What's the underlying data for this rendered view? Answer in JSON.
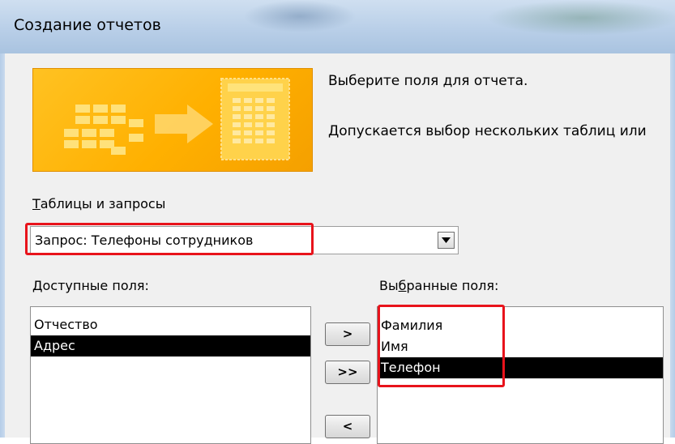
{
  "window": {
    "title": "Создание отчетов"
  },
  "instructions": {
    "line1": "Выберите поля для отчета.",
    "line2": "Допускается выбор нескольких таблиц или"
  },
  "tables": {
    "label_prefix": "",
    "label_accel": "Т",
    "label_rest": "аблицы и запросы",
    "selected": "Запрос: Телефоны сотрудников"
  },
  "available": {
    "label_accel": "Д",
    "label_rest": "оступные поля:",
    "items": [
      "Отчество",
      "Адрес"
    ],
    "selected_index": 1
  },
  "selected_fields": {
    "label_prefix": "Вы",
    "label_accel": "б",
    "label_rest": "ранные поля:",
    "items": [
      "Фамилия",
      "Имя",
      "Телефон"
    ],
    "selected_index": 2
  },
  "buttons": {
    "add_one": ">",
    "add_all": ">>",
    "remove_one": "<"
  },
  "colors": {
    "highlight": "#e8131b",
    "banner": "#ffb000",
    "selection": "#000000"
  }
}
